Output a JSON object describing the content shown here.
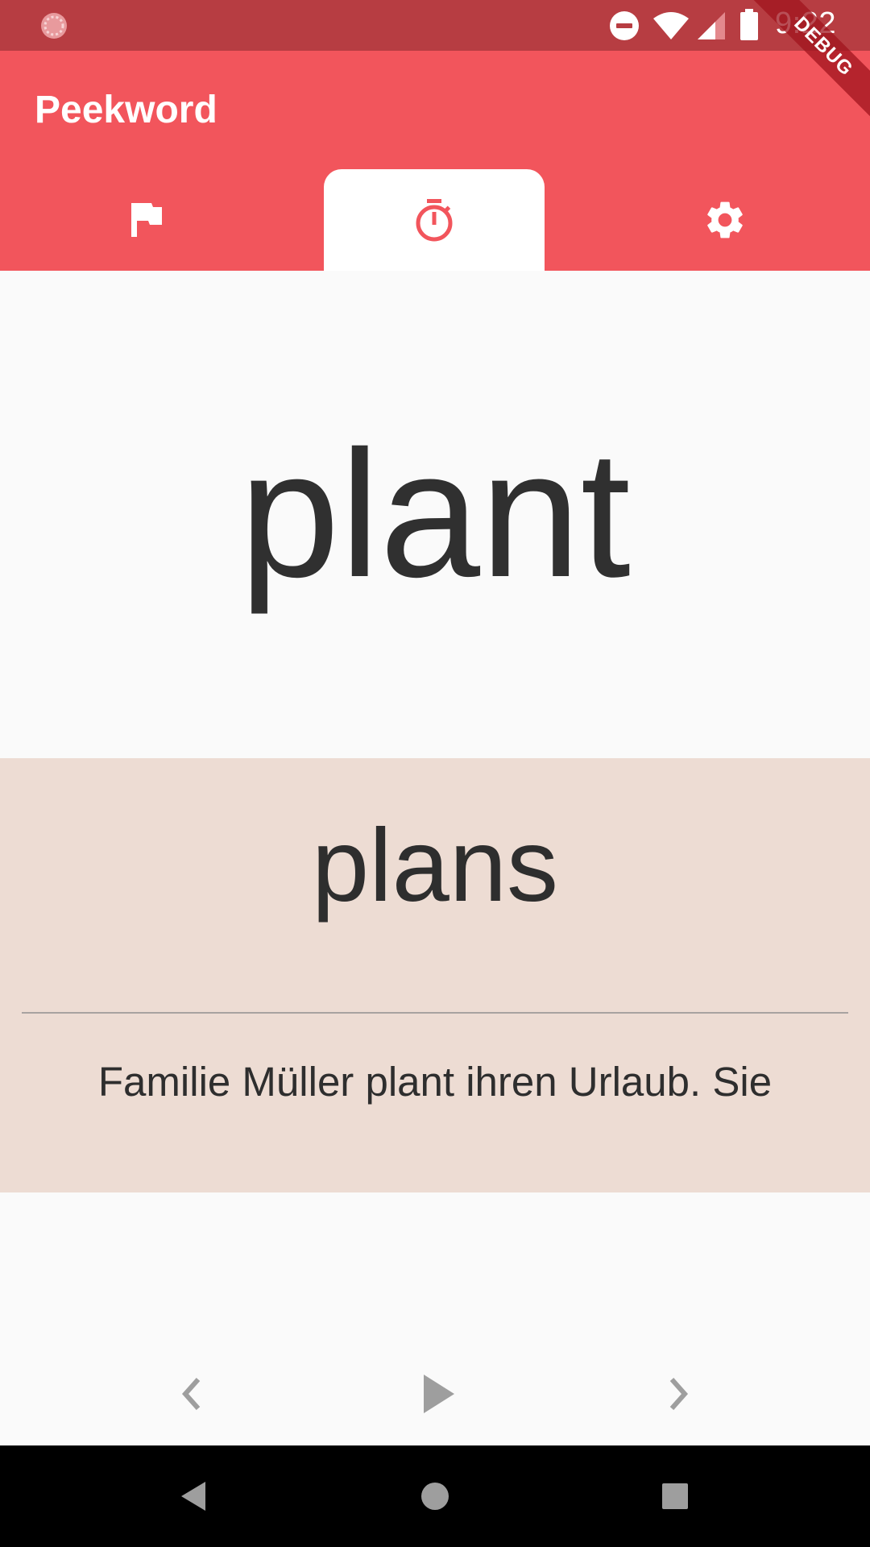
{
  "status_bar": {
    "time": "9:22",
    "left_icon": "loading-circle-icon",
    "icons": [
      "do-not-disturb-icon",
      "wifi-icon",
      "cellular-signal-icon",
      "battery-icon"
    ]
  },
  "debug_banner": "DEBUG",
  "app_bar": {
    "title": "Peekword",
    "tabs": [
      {
        "icon": "flag-icon",
        "active": false
      },
      {
        "icon": "timer-icon",
        "active": true
      },
      {
        "icon": "gear-icon",
        "active": false
      }
    ]
  },
  "card": {
    "word": "plant",
    "translation": "plans",
    "example": "Familie Müller plant ihren Urlaub. Sie"
  },
  "controls": {
    "previous_icon": "chevron-left-icon",
    "play_icon": "play-icon",
    "next_icon": "chevron-right-icon"
  },
  "colors": {
    "status_bar": "#b73d42",
    "app_bar": "#f2555c",
    "translation_panel": "#eddcd3",
    "text": "#303030",
    "control_icon": "#9e9e9e"
  }
}
